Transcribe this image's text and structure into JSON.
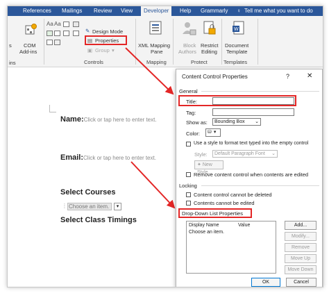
{
  "ribbon": {
    "tabs": [
      {
        "label": "References"
      },
      {
        "label": "Mailings"
      },
      {
        "label": "Review"
      },
      {
        "label": "View"
      },
      {
        "label": "Developer"
      },
      {
        "label": "Help"
      },
      {
        "label": "Grammarly"
      },
      {
        "label": "Tell me what you want to do"
      }
    ],
    "addins": {
      "com_line1": "COM",
      "com_line2": "Add-ins",
      "left_fragment1": "s",
      "left_fragment2": "ins"
    },
    "controls": {
      "design_mode": "Design Mode",
      "properties": "Properties",
      "group": "Group",
      "group_label": "Controls"
    },
    "mapping": {
      "line1": "XML Mapping",
      "line2": "Pane",
      "group_label": "Mapping"
    },
    "protect": {
      "block_line1": "Block",
      "block_line2": "Authors",
      "restrict_line1": "Restrict",
      "restrict_line2": "Editing",
      "group_label": "Protect"
    },
    "templates": {
      "line1": "Document",
      "line2": "Template",
      "group_label": "Templates"
    }
  },
  "document": {
    "name_label": "Name:",
    "name_placeholder": "Click or tap here to enter text.",
    "email_label": "Email:",
    "email_placeholder": "Click or tap here to enter text.",
    "courses_heading": "Select Courses",
    "dropdown_value": "Choose an item.",
    "timings_heading": "Select Class Timings"
  },
  "dialog": {
    "title": "Content Control Properties",
    "help": "?",
    "close": "✕",
    "general_heading": "General",
    "title_label": "Title:",
    "title_value": "",
    "tag_label": "Tag:",
    "tag_value": "",
    "show_as_label": "Show as:",
    "show_as_value": "Bounding Box",
    "color_label": "Color:",
    "use_style_label": "Use a style to format text typed into the empty control",
    "style_label": "Style:",
    "style_value": "Default Paragraph Font",
    "new_style_label": "New Style...",
    "remove_label": "Remove content control when contents are edited",
    "locking_heading": "Locking",
    "lock_delete_label": "Content control cannot be deleted",
    "lock_edit_label": "Contents cannot be edited",
    "dropdown_heading": "Drop-Down List Properties",
    "col_display": "Display Name",
    "col_value": "Value",
    "list_items": [
      {
        "display": "Choose an item.",
        "value": ""
      }
    ],
    "btn_add": "Add...",
    "btn_modify": "Modify...",
    "btn_remove": "Remove",
    "btn_move_up": "Move Up",
    "btn_move_down": "Move Down",
    "btn_ok": "OK",
    "btn_cancel": "Cancel"
  },
  "colors": {
    "ribbon_blue": "#2b579a",
    "highlight_red": "#e32626",
    "ok_border": "#0078d4"
  }
}
